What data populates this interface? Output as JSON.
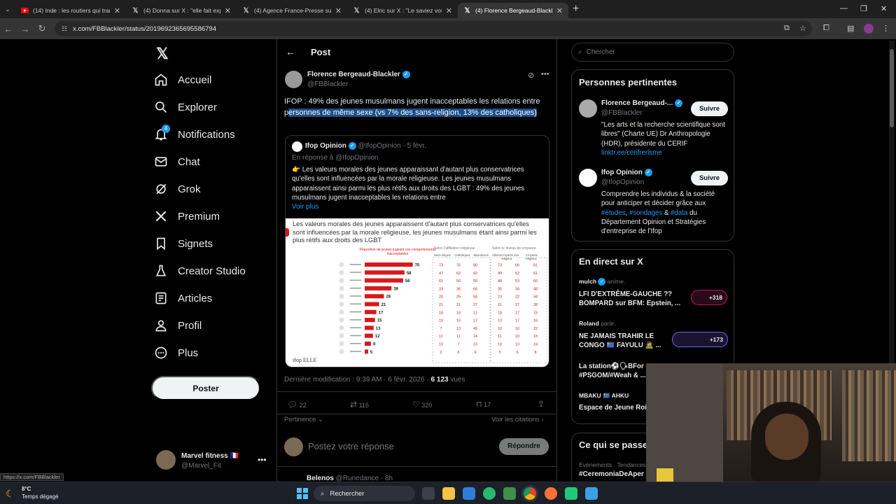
{
  "browser": {
    "tabs": [
      {
        "title": "(14) Inde : les routiers qui trans",
        "icon": "youtube-icon"
      },
      {
        "title": "(4) Donna sur X : \"elle fait expr",
        "icon": "x-icon"
      },
      {
        "title": "(4) Agence France-Presse sur X",
        "icon": "x-icon"
      },
      {
        "title": "(4) Elric sur X : \"Le saviez vous?",
        "icon": "x-icon"
      },
      {
        "title": "(4) Florence Bergeaud-Blackler",
        "icon": "x-icon"
      }
    ],
    "url": "x.com/FBBlackler/status/2019692365695586794",
    "status_url": "https://x.com/FBBlackler"
  },
  "sidebar": {
    "items": [
      {
        "label": "Accueil",
        "icon": "home-icon"
      },
      {
        "label": "Explorer",
        "icon": "search-icon"
      },
      {
        "label": "Notifications",
        "icon": "bell-icon",
        "badge": "4"
      },
      {
        "label": "Chat",
        "icon": "mail-icon"
      },
      {
        "label": "Grok",
        "icon": "grok-icon"
      },
      {
        "label": "Premium",
        "icon": "x-icon"
      },
      {
        "label": "Signets",
        "icon": "bookmark-icon"
      },
      {
        "label": "Creator Studio",
        "icon": "flask-icon"
      },
      {
        "label": "Articles",
        "icon": "article-icon"
      },
      {
        "label": "Profil",
        "icon": "person-icon"
      },
      {
        "label": "Plus",
        "icon": "more-circle-icon"
      }
    ],
    "post_button": "Poster",
    "account": {
      "name": "Marvel fitness 🇫🇷",
      "handle": "@Marvel_Fit"
    }
  },
  "header": {
    "title": "Post"
  },
  "post": {
    "author": "Florence Bergeaud-Blackler",
    "handle": "@FBBlackler",
    "text_plain": "IFOP : 49% des jeunes musulmans jugent inacceptables les relations entre p",
    "text_highlight": "ersonnes de même sexe (vs 7% des sans-religion, 13% des catholiques)",
    "meta_time": "Dernière modification : 9:39 AM · 6 févr. 2026 · ",
    "views_count": "6 123",
    "views_label": " vues",
    "stats": {
      "replies": "22",
      "reposts": "115",
      "likes": "320",
      "bookmarks": "17"
    },
    "relevance": "Pertinence",
    "see_quotes": "Voir les citations",
    "reply_placeholder": "Postez votre réponse",
    "reply_button": "Répondre",
    "next_reply": "Belenos",
    "next_reply_handle": "@Runedance · 8h"
  },
  "quoted": {
    "author": "Ifop Opinion",
    "handle": "@IfopOpinion · 5 févr.",
    "reply_to": "En réponse à @IfopOpinion",
    "text": "👉 Les valeurs morales des jeunes apparaissant d'autant plus conservatrices qu'elles sont influencées par la morale religieuse. Les jeunes musulmans apparaissent ainsi parmi les plus rétifs aux droits des LGBT : 49% des jeunes musulmans jugent inacceptables les relations entre",
    "more": "Voir plus",
    "image_title": "Les valeurs morales des jeunes apparaissent d'autant plus conservatrices qu'elles sont influencées par la morale religieuse, les jeunes musulmans étant ainsi parmi les plus rétifs aux droits des LGBT",
    "image_subtitle_1": "Proportion de jeunes jugeant ces comportements inacceptables",
    "image_subtitle_2": "Selon l'affiliation religieuse",
    "image_subtitle_3": "Selon le niveau de croyance",
    "col_labels": [
      "Sans religion",
      "Catholiques",
      "Musulmans"
    ],
    "col_labels_2": [
      "Athées",
      "Croyants non religieux",
      "Croyants religieux"
    ],
    "brand": "ifop ELLE"
  },
  "chart_data": {
    "type": "bar",
    "categories": [
      "",
      "",
      "",
      "",
      "",
      "",
      "",
      "",
      "",
      "",
      "",
      ""
    ],
    "values": [
      70,
      58,
      56,
      39,
      28,
      21,
      17,
      15,
      13,
      12,
      9,
      5
    ],
    "by_religion": [
      [
        73,
        76,
        80
      ],
      [
        47,
        62,
        92
      ],
      [
        61,
        56,
        56
      ],
      [
        33,
        36,
        66
      ],
      [
        20,
        25,
        58
      ],
      [
        21,
        31,
        27
      ],
      [
        18,
        18,
        11
      ],
      [
        10,
        16,
        17
      ],
      [
        7,
        13,
        49
      ],
      [
        11,
        11,
        14
      ],
      [
        10,
        7,
        10
      ],
      [
        2,
        6,
        9
      ]
    ],
    "by_belief": [
      [
        73,
        66,
        81
      ],
      [
        49,
        52,
        61
      ],
      [
        48,
        53,
        60
      ],
      [
        35,
        34,
        48
      ],
      [
        23,
        22,
        44
      ],
      [
        21,
        27,
        28
      ],
      [
        18,
        17,
        15
      ],
      [
        13,
        17,
        16
      ],
      [
        10,
        10,
        22
      ],
      [
        11,
        10,
        15
      ],
      [
        10,
        10,
        24
      ],
      [
        5,
        6,
        8
      ]
    ],
    "bar_color": "#d7191c",
    "xlim": [
      0,
      100
    ]
  },
  "right": {
    "search_placeholder": "Chercher",
    "pertinent_title": "Personnes pertinentes",
    "people": [
      {
        "name": "Florence Bergeaud-...",
        "handle": "@FBBlackler",
        "follow": "Suivre",
        "bio": "\"Les arts et la recherche scientifique sont libres\" (Charte UE) Dr Anthropologie (HDR), présidente du CERIF ",
        "bio_link": "linktr.ee/cerifrerisme"
      },
      {
        "name": "Ifop Opinion",
        "handle": "@IfopOpinion",
        "follow": "Suivre",
        "bio_1": "Comprendre les individus & la société pour anticiper et décider grâce aux ",
        "tag_1": "#études",
        "sep_1": ", ",
        "tag_2": "#sondages",
        "sep_2": " & ",
        "tag_3": "#data",
        "bio_2": " du Département Opinion et Stratégies d'entreprise de l'Ifop"
      }
    ],
    "live_title": "En direct sur X",
    "live": [
      {
        "host": "mulch",
        "action": "anime.",
        "title": "LFI D'EXTRÊME-GAUCHE ?? BOMPARD sur BFM: Epstein, ...",
        "count": "+318"
      },
      {
        "host": "Roland",
        "action": "parle.",
        "title": "NE JAMAIS TRAHIR LE CONGO 🇨🇩 FAYULU 🧟 ...",
        "count": "+173"
      },
      {
        "host": "",
        "action": "",
        "title": "La station⚽🗣BFor #PSGOM/#Weah & ...",
        "count": ""
      },
      {
        "host": "MBAKU 🇨🇩 AHKU",
        "action": "",
        "title": "Espace de Jeune Roi",
        "count": ""
      }
    ],
    "trends_title": "Ce qui se passe",
    "trend_category": "Événements · Tendances",
    "trend_name": "#CeremoniaDeAper"
  },
  "taskbar": {
    "weather_temp": "8°C",
    "weather_desc": "Temps dégagé",
    "search": "Rechercher"
  },
  "colors": {
    "accent": "#1d9bf0",
    "background": "#000000",
    "highlight": "#1d4e89"
  }
}
